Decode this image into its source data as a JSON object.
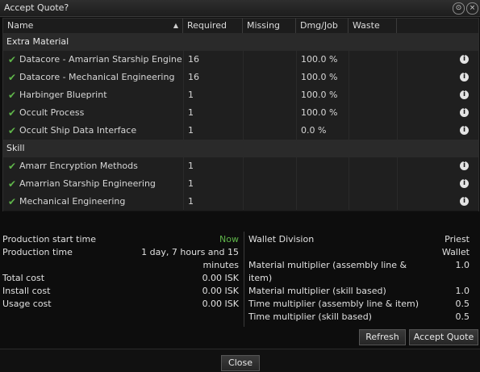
{
  "window": {
    "title": "Accept Quote?"
  },
  "table": {
    "headers": [
      "Name",
      "Required",
      "Missing",
      "Dmg/Job",
      "Waste"
    ],
    "groups": [
      {
        "label": "Extra Material",
        "rows": [
          {
            "name": "Datacore - Amarrian Starship Engine",
            "required": "16",
            "dmg": "100.0 %"
          },
          {
            "name": "Datacore - Mechanical Engineering",
            "required": "16",
            "dmg": "100.0 %"
          },
          {
            "name": "Harbinger Blueprint",
            "required": "1",
            "dmg": "100.0 %"
          },
          {
            "name": "Occult Process",
            "required": "1",
            "dmg": "100.0 %"
          },
          {
            "name": "Occult Ship Data Interface",
            "required": "1",
            "dmg": "0.0 %"
          }
        ]
      },
      {
        "label": "Skill",
        "rows": [
          {
            "name": "Amarr Encryption Methods",
            "required": "1",
            "dmg": ""
          },
          {
            "name": "Amarrian Starship Engineering",
            "required": "1",
            "dmg": ""
          },
          {
            "name": "Mechanical Engineering",
            "required": "1",
            "dmg": ""
          }
        ]
      }
    ]
  },
  "production": {
    "start_label": "Production start time",
    "start_value": "Now",
    "time_label": "Production time",
    "time_value_1": "1 day, 7 hours and 15",
    "time_value_2": "minutes",
    "total_label": "Total cost",
    "total_value": "0.00 ISK",
    "install_label": "Install cost",
    "install_value": "0.00 ISK",
    "usage_label": "Usage cost",
    "usage_value": "0.00 ISK"
  },
  "wallet": {
    "division_label": "Wallet Division",
    "division_value_1": "Priest",
    "division_value_2": "Wallet",
    "mat_line_label_1": "Material multiplier (assembly line &",
    "mat_line_label_2": "item)",
    "mat_line_value": "1.0",
    "mat_skill_label": "Material multiplier (skill based)",
    "mat_skill_value": "1.0",
    "time_line_label": "Time multiplier (assembly line & item)",
    "time_line_value": "0.5",
    "time_skill_label": "Time multiplier (skill based)",
    "time_skill_value": "0.5"
  },
  "buttons": {
    "refresh": "Refresh",
    "accept": "Accept Quote",
    "close": "Close"
  },
  "colors": {
    "check": "#5fb54a",
    "now": "#5fb54a"
  }
}
